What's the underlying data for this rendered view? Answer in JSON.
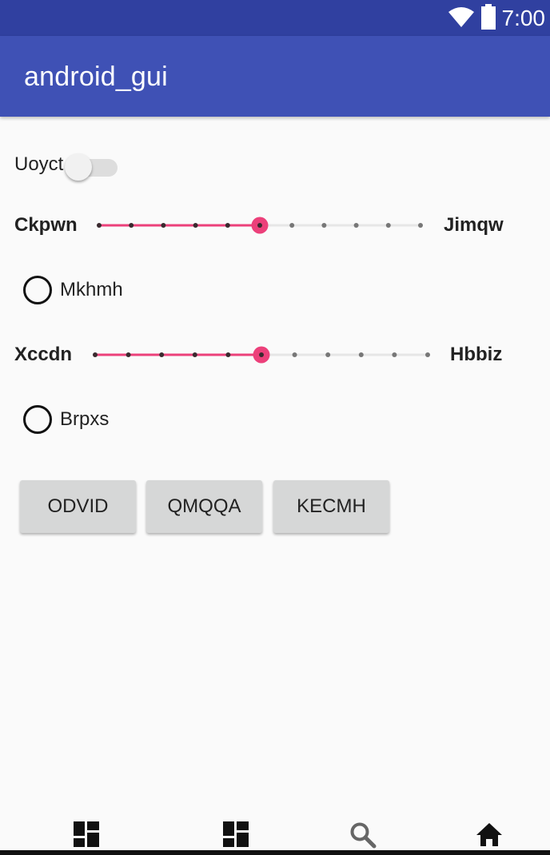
{
  "status_bar": {
    "time": "7:00",
    "icons": [
      "wifi-icon",
      "battery-icon"
    ]
  },
  "app_bar": {
    "title": "android_gui"
  },
  "switch": {
    "label": "Uoyct",
    "checked": false
  },
  "slider1": {
    "left_label": "Ckpwn",
    "right_label": "Jimqw",
    "steps": 10,
    "value": 5
  },
  "radio1": {
    "label": "Mkhmh",
    "checked": false
  },
  "slider2": {
    "left_label": "Xccdn",
    "right_label": "Hbbiz",
    "steps": 10,
    "value": 5
  },
  "radio2": {
    "label": "Brpxs",
    "checked": false
  },
  "buttons": [
    {
      "label": "ODVID"
    },
    {
      "label": "QMQQA"
    },
    {
      "label": "KECMH"
    }
  ],
  "bottom_nav": {
    "icons": [
      "dashboard-icon",
      "dashboard-icon",
      "search-icon",
      "home-icon"
    ]
  },
  "colors": {
    "primary": "#3f51b5",
    "primary_dark": "#3040a0",
    "accent": "#ec407a"
  }
}
